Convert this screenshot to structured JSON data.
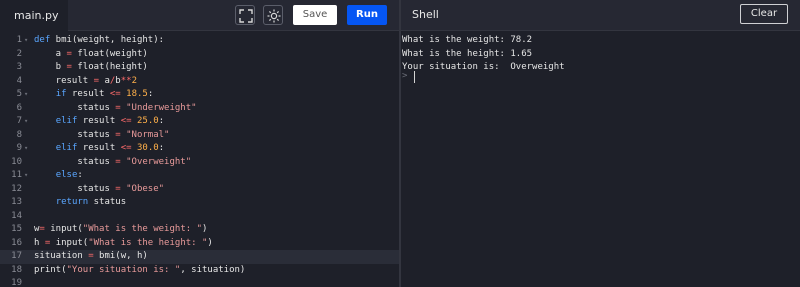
{
  "editor": {
    "file_tab": "main.py",
    "lines": [
      {
        "n": "1",
        "fold": "▾",
        "code": "def bmi(weight, height):"
      },
      {
        "n": "2",
        "fold": "",
        "code": "    a = float(weight)"
      },
      {
        "n": "3",
        "fold": "",
        "code": "    b = float(height)"
      },
      {
        "n": "4",
        "fold": "",
        "code": "    result = a/b**2"
      },
      {
        "n": "5",
        "fold": "▾",
        "code": "    if result <= 18.5:"
      },
      {
        "n": "6",
        "fold": "",
        "code": "        status = \"Underweight\""
      },
      {
        "n": "7",
        "fold": "▾",
        "code": "    elif result <= 25.0:"
      },
      {
        "n": "8",
        "fold": "",
        "code": "        status = \"Normal\""
      },
      {
        "n": "9",
        "fold": "▾",
        "code": "    elif result <= 30.0:"
      },
      {
        "n": "10",
        "fold": "",
        "code": "        status = \"Overweight\""
      },
      {
        "n": "11",
        "fold": "▾",
        "code": "    else:"
      },
      {
        "n": "12",
        "fold": "",
        "code": "        status = \"Obese\""
      },
      {
        "n": "13",
        "fold": "",
        "code": "    return status"
      },
      {
        "n": "14",
        "fold": "",
        "code": ""
      },
      {
        "n": "15",
        "fold": "",
        "code": "w= input(\"What is the weight: \")"
      },
      {
        "n": "16",
        "fold": "",
        "code": "h = input(\"What is the height: \")"
      },
      {
        "n": "17",
        "fold": "",
        "code": "situation = bmi(w, h)"
      },
      {
        "n": "18",
        "fold": "",
        "code": "print(\"Your situation is: \", situation)"
      },
      {
        "n": "19",
        "fold": "",
        "code": ""
      }
    ],
    "active_line": "17"
  },
  "toolbar": {
    "expand_icon": "expand-icon",
    "theme_icon": "sun-icon",
    "save_label": "Save",
    "run_label": "Run"
  },
  "shell": {
    "title": "Shell",
    "clear_label": "Clear",
    "output": [
      "What is the weight: 78.2",
      "What is the height: 1.65",
      "Your situation is:  Overweight"
    ],
    "prompt": ">"
  },
  "colors": {
    "run_button": "#0556f3",
    "background": "#1e2029",
    "keyword": "#5aa6ff",
    "string": "#e89a9a",
    "number": "#ffb04a"
  }
}
